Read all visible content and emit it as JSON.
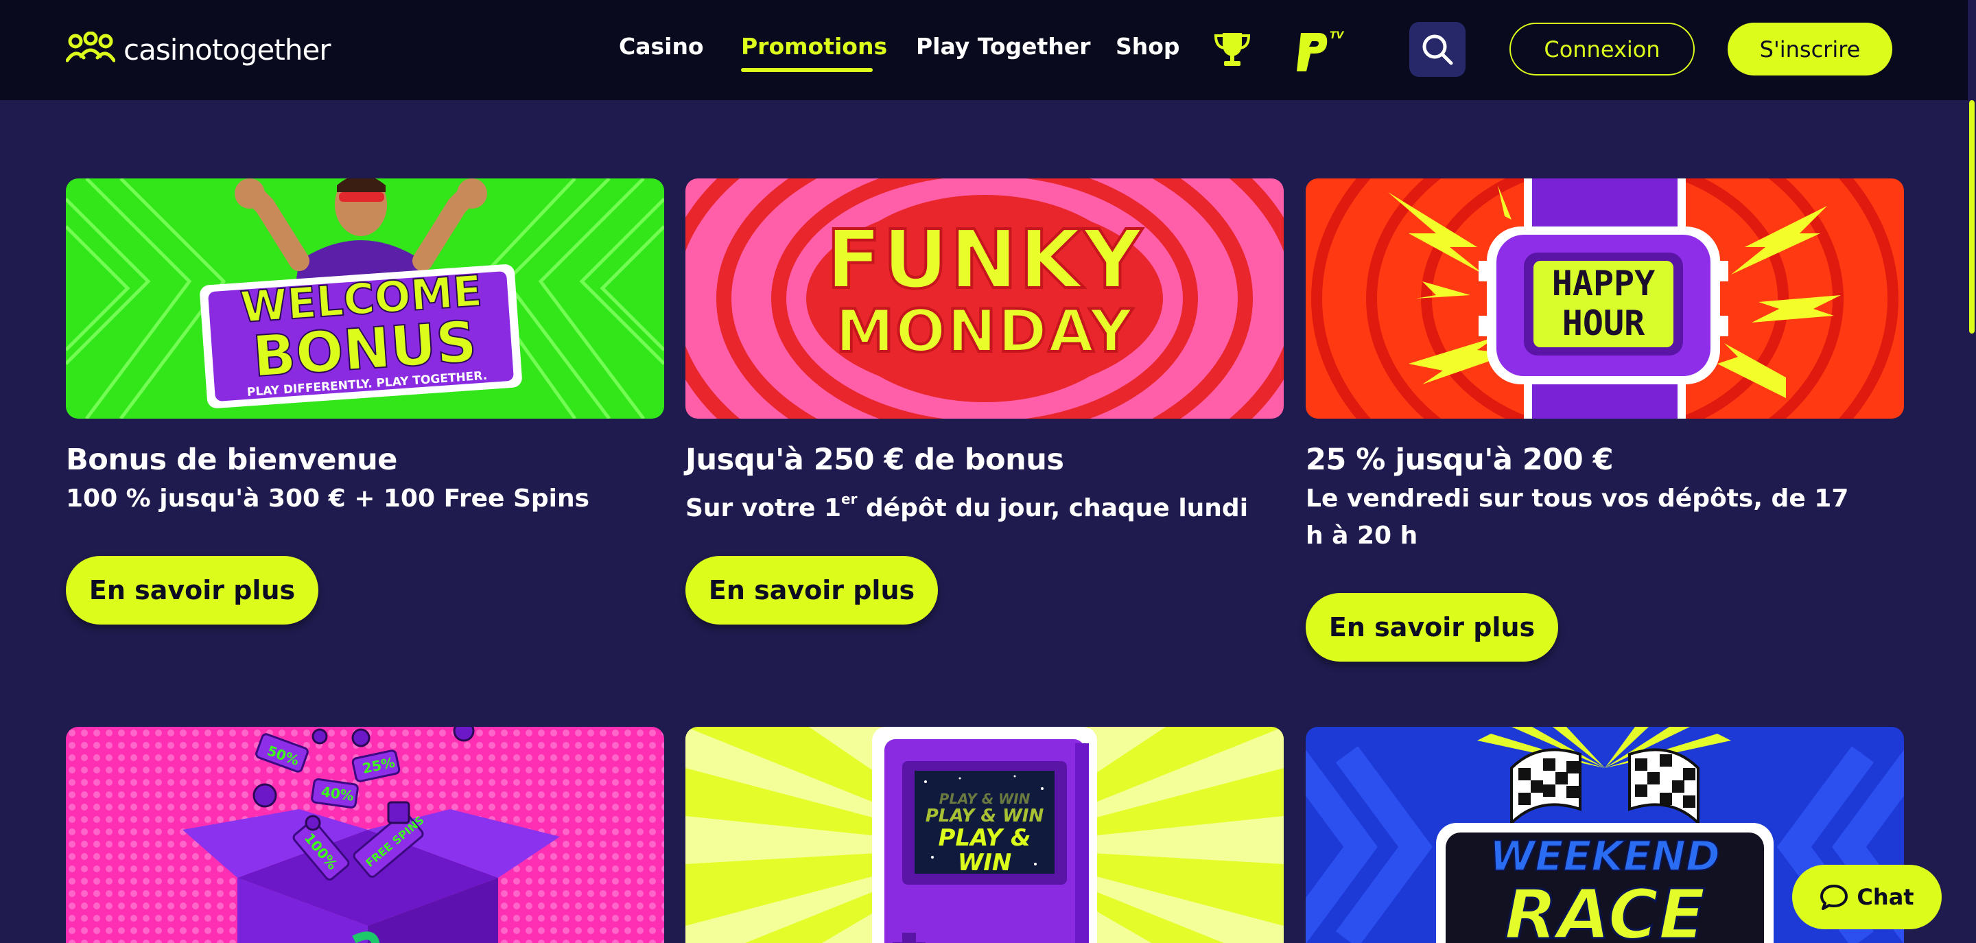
{
  "brand": {
    "name": "casinotogether"
  },
  "nav": {
    "links": [
      {
        "label": "Casino",
        "active": false
      },
      {
        "label": "Promotions",
        "active": true
      },
      {
        "label": "Play Together",
        "active": false
      },
      {
        "label": "Shop",
        "active": false
      }
    ],
    "trophy_icon": "trophy-icon",
    "ptv_icon": "ptv-logo-icon",
    "search_icon": "search-icon",
    "login_label": "Connexion",
    "signup_label": "S'inscrire"
  },
  "colors": {
    "accent": "#dcfd1c",
    "background": "#1f1b4e",
    "nav_bg": "#090a1e"
  },
  "promotions": [
    {
      "banner_text_line1": "WELCOME",
      "banner_text_line2": "BONUS",
      "banner_tagline": "PLAY DIFFERENTLY. PLAY TOGETHER.",
      "title": "Bonus de bienvenue",
      "subtitle": "100 % jusqu'à 300 € + 100 Free Spins",
      "button": "En savoir plus"
    },
    {
      "banner_text_line1": "FUNKY",
      "banner_text_line2": "MONDAY",
      "title": "Jusqu'à 250 € de bonus",
      "subtitle_prefix": "Sur votre 1",
      "subtitle_sup": "er",
      "subtitle_suffix": " dépôt du jour, chaque lundi",
      "button": "En savoir plus"
    },
    {
      "banner_text_line1": "HAPPY",
      "banner_text_line2": "HOUR",
      "title": "25 % jusqu'à 200 €",
      "subtitle": "Le vendredi sur tous vos dépôts, de 17 h à 20 h",
      "button": "En savoir plus"
    },
    {
      "banner_labels": [
        "50%",
        "25%",
        "40%",
        "100%",
        "FREE SPINS"
      ]
    },
    {
      "banner_text": [
        "PLAY & WIN",
        "PLAY & WIN",
        "PLAY & WIN"
      ]
    },
    {
      "banner_text_line1": "WEEKEND",
      "banner_text_line2": "RACE"
    }
  ],
  "chat": {
    "label": "Chat"
  }
}
